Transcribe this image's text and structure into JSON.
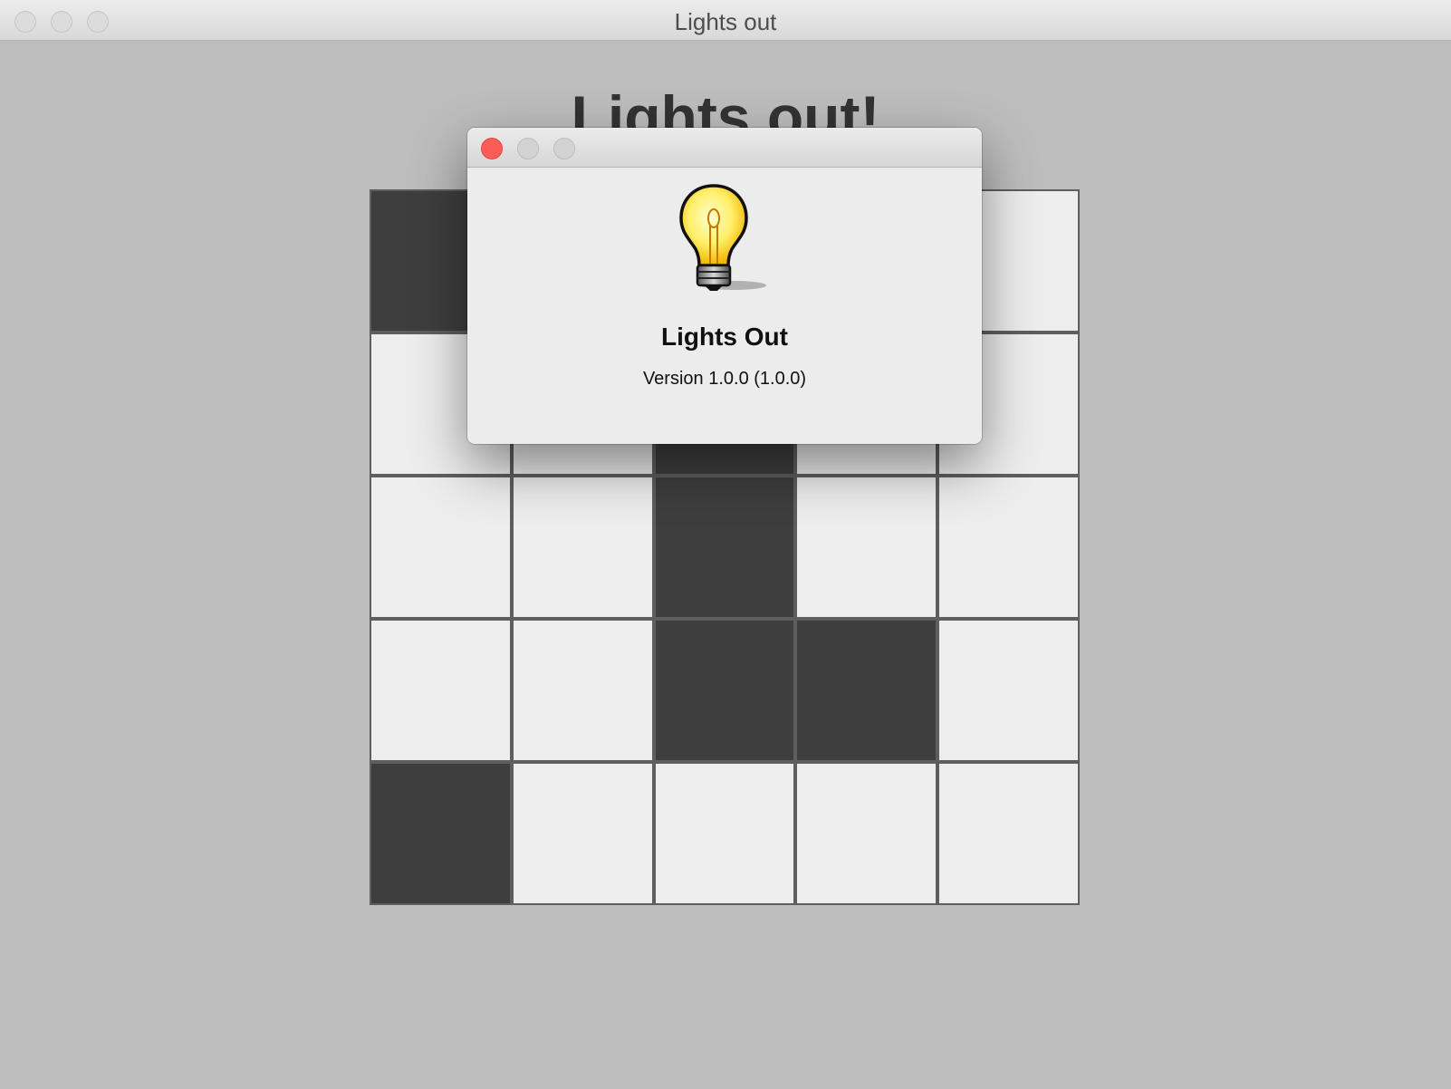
{
  "window": {
    "title": "Lights out"
  },
  "game": {
    "heading": "Lights out!",
    "board": [
      [
        1,
        0,
        0,
        0,
        0
      ],
      [
        0,
        0,
        1,
        0,
        0
      ],
      [
        0,
        0,
        1,
        0,
        0
      ],
      [
        0,
        0,
        1,
        1,
        0
      ],
      [
        1,
        0,
        0,
        0,
        0
      ]
    ]
  },
  "about": {
    "app_name": "Lights Out",
    "version": "Version 1.0.0 (1.0.0)",
    "icon": "lightbulb-icon"
  },
  "colors": {
    "light_on": "#3e3e3e",
    "light_off": "#ededed",
    "grid_lines": "#5e5e5e",
    "close_button": "#fc5c56"
  }
}
